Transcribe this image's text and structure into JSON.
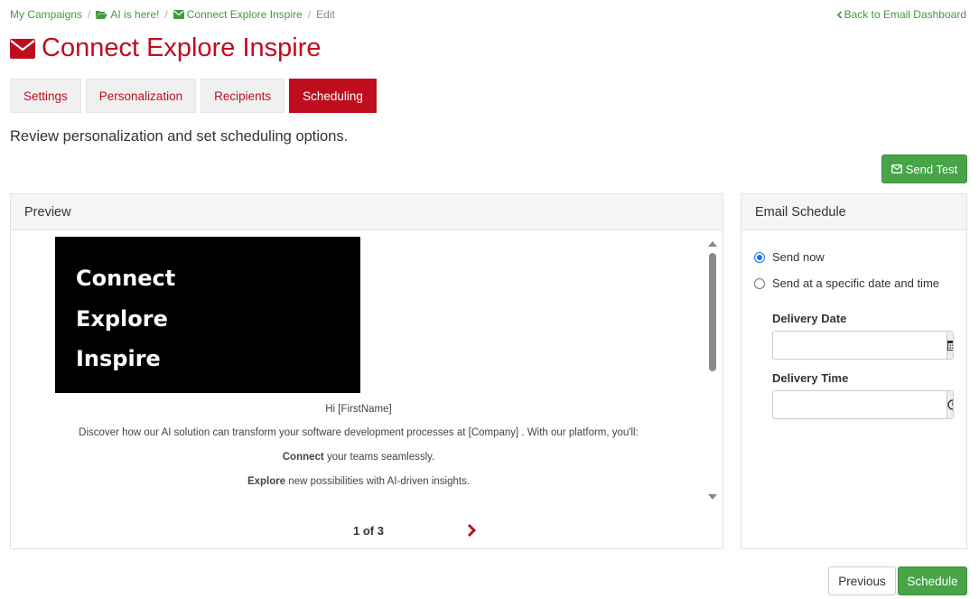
{
  "breadcrumb": {
    "items": [
      "My Campaigns",
      "AI is here!",
      "Connect Explore Inspire"
    ],
    "current": "Edit"
  },
  "back_link": "Back to Email Dashboard",
  "page": {
    "title": "Connect Explore Inspire",
    "subtitle": "Review personalization and set scheduling options."
  },
  "tabs": [
    {
      "label": "Settings",
      "active": false
    },
    {
      "label": "Personalization",
      "active": false
    },
    {
      "label": "Recipients",
      "active": false
    },
    {
      "label": "Scheduling",
      "active": true
    }
  ],
  "send_test_label": "Send Test",
  "preview": {
    "heading": "Preview",
    "hero_lines": [
      "Connect",
      "Explore",
      "Inspire"
    ],
    "greeting": "Hi [FirstName]",
    "intro": "Discover how our AI solution can transform your software development processes at [Company] . With our platform, you'll:",
    "bullets": [
      {
        "bold": "Connect",
        "rest": " your teams seamlessly."
      },
      {
        "bold": "Explore",
        "rest": " new possibilities with AI-driven insights."
      }
    ],
    "pager": "1 of 3"
  },
  "schedule": {
    "heading": "Email Schedule",
    "options": [
      {
        "label": "Send now",
        "checked": true
      },
      {
        "label": "Send at a specific date and time",
        "checked": false
      }
    ],
    "delivery_date_label": "Delivery Date",
    "delivery_date_value": "",
    "delivery_time_label": "Delivery Time",
    "delivery_time_value": ""
  },
  "footer": {
    "previous_label": "Previous",
    "schedule_label": "Schedule"
  },
  "colors": {
    "brand_red": "#c00d1e",
    "success_green": "#47a447",
    "link_green": "#3f9b3a"
  }
}
